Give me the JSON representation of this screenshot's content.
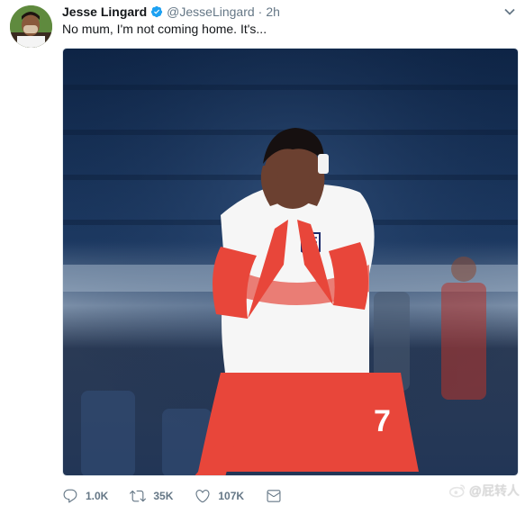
{
  "tweet": {
    "author": {
      "name": "Jesse Lingard",
      "handle": "@JesseLingard",
      "verified": true,
      "avatar_icon": "profile-photo"
    },
    "separator": "·",
    "time": "2h",
    "text": "No mum, I'm not coming home. It's...",
    "media": {
      "type": "photo",
      "shirt_number": "7"
    },
    "actions": [
      {
        "icon": "reply-icon",
        "count": "1.0K"
      },
      {
        "icon": "retweet-icon",
        "count": "35K"
      },
      {
        "icon": "like-icon",
        "count": "107K"
      },
      {
        "icon": "message-icon",
        "count": ""
      }
    ],
    "accent_color": "#1da1f2",
    "muted_color": "#657786"
  },
  "watermark": {
    "icon": "weibo-icon",
    "text": "@屁转人"
  }
}
